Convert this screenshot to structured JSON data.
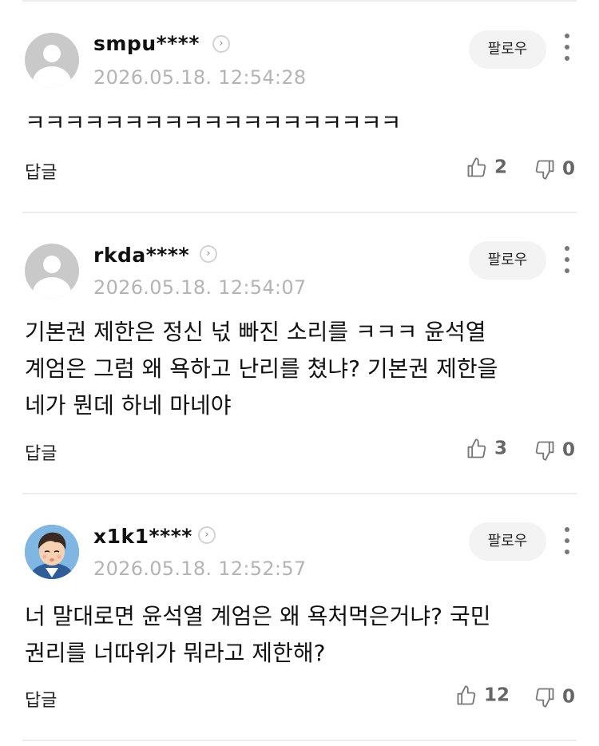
{
  "comments": [
    {
      "username": "smpu****",
      "timestamp": "2026.05.18. 12:54:28",
      "follow_label": "팔로우",
      "text": "ㅋㅋㅋㅋㅋㅋㅋㅋㅋㅋㅋㅋㅋㅋㅋㅋㅋㅋㅋ",
      "reply_label": "답글",
      "likes": "2",
      "dislikes": "0"
    },
    {
      "username": "rkda****",
      "timestamp": "2026.05.18. 12:54:07",
      "follow_label": "팔로우",
      "text_lines": [
        "기본권 제한은 정신 넋 빠진 소리를 ㅋㅋㅋ 윤석열",
        "계엄은 그럼 왜 욕하고 난리를 쳤냐? 기본권 제한을",
        "네가 뭔데 하네 마네야"
      ],
      "reply_label": "답글",
      "likes": "3",
      "dislikes": "0"
    },
    {
      "username": "x1k1****",
      "timestamp": "2026.05.18. 12:52:57",
      "follow_label": "팔로우",
      "text_lines": [
        "너 말대로면 윤석열 계엄은 왜 욕처먹은거냐? 국민",
        "권리를 너따위가 뭐라고 제한해?"
      ],
      "reply_label": "답글",
      "likes": "12",
      "dislikes": "0"
    }
  ]
}
